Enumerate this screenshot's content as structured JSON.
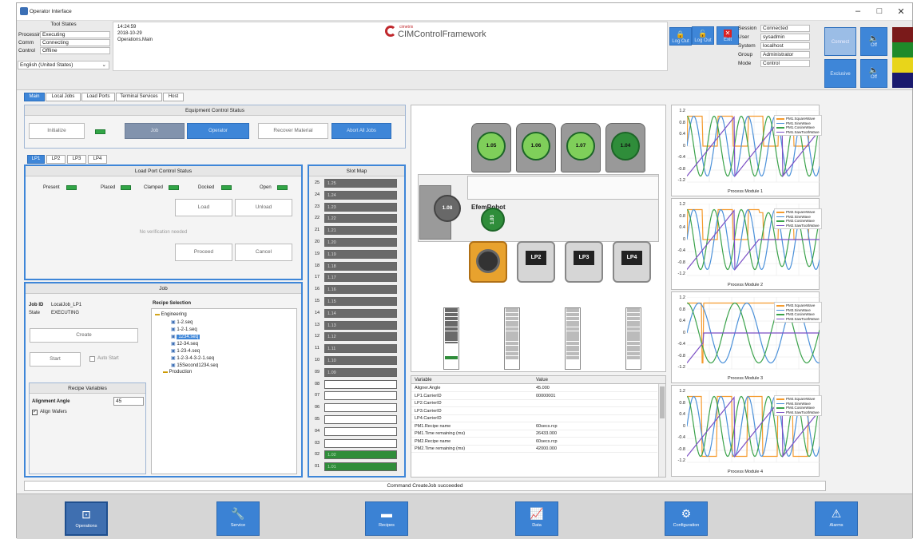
{
  "window": {
    "title": "Operator Interface",
    "min": "–",
    "max": "□",
    "close": "✕"
  },
  "header": {
    "tool_states_title": "Tool States",
    "states": [
      {
        "label": "Processing",
        "value": "Executing"
      },
      {
        "label": "Comm",
        "value": "Connecting"
      },
      {
        "label": "Control",
        "value": "Offline"
      }
    ],
    "language": "English (United States)",
    "time": "14:24:59",
    "date": "2018-10-29",
    "screen": "Operations.Main",
    "logo_small": "cimetrix",
    "logo_text": "CIMControlFramework",
    "logout_label": "Log Out",
    "exit_label": "Exit",
    "session": [
      {
        "label": "Session",
        "value": "Connected"
      },
      {
        "label": "User",
        "value": "sysadmin"
      },
      {
        "label": "System",
        "value": "localhost"
      },
      {
        "label": "Group",
        "value": "Administrator"
      },
      {
        "label": "Mode",
        "value": "Control"
      }
    ],
    "connect_label": "Connect",
    "exclusive_label": "Exclusive",
    "sound1_label": "Off",
    "sound2_label": "Off",
    "signal_colors": [
      "#7a1a1a",
      "#1f8a2a",
      "#e8d51a",
      "#1a1a6e"
    ]
  },
  "main_tabs": [
    "Main",
    "Local Jobs",
    "Load Ports",
    "Terminal Services",
    "Host"
  ],
  "equipment": {
    "title": "Equipment Control Status",
    "initialize": "Initialize",
    "job": "Job",
    "operator": "Operator",
    "recover": "Recover Material",
    "abort": "Abort All Jobs"
  },
  "lp_tabs": [
    "LP1",
    "LP2",
    "LP3",
    "LP4"
  ],
  "loadport": {
    "title": "Load Port Control Status",
    "leds": [
      "Present",
      "Placed",
      "Clamped",
      "Docked",
      "Open"
    ],
    "load": "Load",
    "unload": "Unload",
    "message": "No verification needed",
    "proceed": "Proceed",
    "cancel": "Cancel"
  },
  "slotmap": {
    "title": "Slot Map",
    "slots": [
      {
        "n": "25",
        "v": "1.25",
        "s": "fill"
      },
      {
        "n": "24",
        "v": "1.24",
        "s": "fill"
      },
      {
        "n": "23",
        "v": "1.23",
        "s": "fill"
      },
      {
        "n": "22",
        "v": "1.22",
        "s": "fill"
      },
      {
        "n": "21",
        "v": "1.21",
        "s": "fill"
      },
      {
        "n": "20",
        "v": "1.20",
        "s": "fill"
      },
      {
        "n": "19",
        "v": "1.19",
        "s": "fill"
      },
      {
        "n": "18",
        "v": "1.18",
        "s": "fill"
      },
      {
        "n": "17",
        "v": "1.17",
        "s": "fill"
      },
      {
        "n": "16",
        "v": "1.16",
        "s": "fill"
      },
      {
        "n": "15",
        "v": "1.15",
        "s": "fill"
      },
      {
        "n": "14",
        "v": "1.14",
        "s": "fill"
      },
      {
        "n": "13",
        "v": "1.13",
        "s": "fill"
      },
      {
        "n": "12",
        "v": "1.12",
        "s": "fill"
      },
      {
        "n": "11",
        "v": "1.11",
        "s": "fill"
      },
      {
        "n": "10",
        "v": "1.10",
        "s": "fill"
      },
      {
        "n": "09",
        "v": "1.09",
        "s": "fill"
      },
      {
        "n": "08",
        "v": "",
        "s": "empty"
      },
      {
        "n": "07",
        "v": "",
        "s": "empty"
      },
      {
        "n": "06",
        "v": "",
        "s": "empty"
      },
      {
        "n": "05",
        "v": "",
        "s": "empty"
      },
      {
        "n": "04",
        "v": "",
        "s": "empty"
      },
      {
        "n": "03",
        "v": "",
        "s": "empty"
      },
      {
        "n": "02",
        "v": "1.02",
        "s": "green"
      },
      {
        "n": "01",
        "v": "1.01",
        "s": "green"
      }
    ]
  },
  "job": {
    "title": "Job",
    "id_label": "Job ID",
    "id_value": "LocalJob_LP1",
    "state_label": "State",
    "state_value": "EXECUTING",
    "create": "Create",
    "start": "Start",
    "auto_start": "Auto Start",
    "recipe_selection": "Recipe Selection",
    "tree": {
      "engineering": "Engineering",
      "files": [
        "1-2.seq",
        "1-2-1.seq",
        "1234.seq",
        "12-34.seq",
        "1-23-4.seq",
        "1-2-3-4-3-2-1.seq",
        "15Second1234.seq"
      ],
      "production": "Production"
    }
  },
  "recipe_vars": {
    "title": "Recipe Variables",
    "angle_label": "Alignment Angle",
    "angle_value": "45",
    "align_label": "Align Wafers"
  },
  "tool": {
    "pms": [
      "1.05",
      "1.06",
      "1.07",
      "1.04"
    ],
    "aligner": "1.08",
    "robot": "EfemRobot",
    "robot_wafer": "1.03",
    "lps": [
      "LP2",
      "LP3",
      "LP4"
    ]
  },
  "vartable": {
    "col1": "Variable",
    "col2": "Value",
    "rows": [
      {
        "k": "Aligner.Angle",
        "v": "45.000"
      },
      {
        "k": "LP1.CarrierID",
        "v": "00000001"
      },
      {
        "k": "LP2.CarrierID",
        "v": ""
      },
      {
        "k": "LP3.CarrierID",
        "v": ""
      },
      {
        "k": "LP4.CarrierID",
        "v": ""
      },
      {
        "k": "PM1.Recipe name",
        "v": "60secs.rcp"
      },
      {
        "k": "PM1.Time remaining (ms)",
        "v": "26433.000"
      },
      {
        "k": "PM2.Recipe name",
        "v": "60secs.rcp"
      },
      {
        "k": "PM2.Time remaining (ms)",
        "v": "42000.000"
      }
    ]
  },
  "status": "Command CreateJob succeeded",
  "nav": [
    "Operations",
    "Service",
    "Recipes",
    "Data",
    "Configuration",
    "Alarms"
  ],
  "chart_data": [
    {
      "type": "line",
      "title": "Process Module 1",
      "ylim": [
        -1.2,
        1.2
      ],
      "yticks": [
        "1.2",
        "0.8",
        "0.4",
        "0",
        "-0.4",
        "-0.8",
        "-1.2"
      ],
      "series": [
        {
          "name": "PM1.SquareWave",
          "color": "#f59b2e"
        },
        {
          "name": "PM1.SineWave",
          "color": "#4a90d9"
        },
        {
          "name": "PM1.CosineWave",
          "color": "#3aa24a"
        },
        {
          "name": "PM1.SawToothWave",
          "color": "#7b4fc4"
        }
      ]
    },
    {
      "type": "line",
      "title": "Process Module 2",
      "ylim": [
        -1.2,
        1.2
      ],
      "yticks": [
        "1.2",
        "0.8",
        "0.4",
        "0",
        "-0.4",
        "-0.8",
        "-1.2"
      ],
      "series": [
        {
          "name": "PM2.SquareWave",
          "color": "#f59b2e"
        },
        {
          "name": "PM2.SineWave",
          "color": "#4a90d9"
        },
        {
          "name": "PM2.CosineWave",
          "color": "#3aa24a"
        },
        {
          "name": "PM2.SawToothWave",
          "color": "#7b4fc4"
        }
      ]
    },
    {
      "type": "line",
      "title": "Process Module 3",
      "ylim": [
        -1.2,
        1.2
      ],
      "yticks": [
        "1.2",
        "0.8",
        "0.4",
        "0",
        "-0.4",
        "-0.8",
        "-1.2"
      ],
      "series": [
        {
          "name": "PM3.SquareWave",
          "color": "#f59b2e"
        },
        {
          "name": "PM3.SineWave",
          "color": "#4a90d9"
        },
        {
          "name": "PM3.CosineWave",
          "color": "#3aa24a"
        },
        {
          "name": "PM3.SawToothWave",
          "color": "#7b4fc4"
        }
      ]
    },
    {
      "type": "line",
      "title": "Process Module 4",
      "ylim": [
        -1.2,
        1.2
      ],
      "yticks": [
        "1.2",
        "0.8",
        "0.4",
        "0",
        "-0.4",
        "-0.8",
        "-1.2"
      ],
      "series": [
        {
          "name": "PM4.SquareWave",
          "color": "#f59b2e"
        },
        {
          "name": "PM4.SineWave",
          "color": "#4a90d9"
        },
        {
          "name": "PM4.CosineWave",
          "color": "#3aa24a"
        },
        {
          "name": "PM4.SawToothWave",
          "color": "#7b4fc4"
        }
      ]
    }
  ]
}
